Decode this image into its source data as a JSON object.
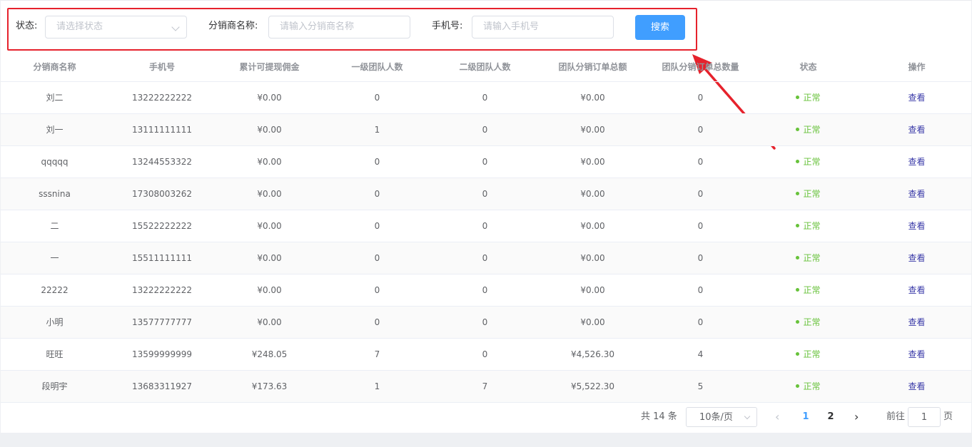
{
  "filters": {
    "status_label": "状态:",
    "status_placeholder": "请选择状态",
    "name_label": "分销商名称:",
    "name_placeholder": "请输入分销商名称",
    "phone_label": "手机号:",
    "phone_placeholder": "请输入手机号",
    "search_label": "搜索"
  },
  "table": {
    "headers": [
      "分销商名称",
      "手机号",
      "累计可提现佣金",
      "一级团队人数",
      "二级团队人数",
      "团队分销订单总额",
      "团队分销订单总数量",
      "状态",
      "操作"
    ],
    "rows": [
      {
        "name": "刘二",
        "phone": "13222222222",
        "commission": "¥0.00",
        "level1": "0",
        "level2": "0",
        "order_total": "¥0.00",
        "order_count": "0",
        "status": "正常",
        "action": "查看"
      },
      {
        "name": "刘一",
        "phone": "13111111111",
        "commission": "¥0.00",
        "level1": "1",
        "level2": "0",
        "order_total": "¥0.00",
        "order_count": "0",
        "status": "正常",
        "action": "查看"
      },
      {
        "name": "qqqqq",
        "phone": "13244553322",
        "commission": "¥0.00",
        "level1": "0",
        "level2": "0",
        "order_total": "¥0.00",
        "order_count": "0",
        "status": "正常",
        "action": "查看"
      },
      {
        "name": "sssnina",
        "phone": "17308003262",
        "commission": "¥0.00",
        "level1": "0",
        "level2": "0",
        "order_total": "¥0.00",
        "order_count": "0",
        "status": "正常",
        "action": "查看"
      },
      {
        "name": "二",
        "phone": "15522222222",
        "commission": "¥0.00",
        "level1": "0",
        "level2": "0",
        "order_total": "¥0.00",
        "order_count": "0",
        "status": "正常",
        "action": "查看"
      },
      {
        "name": "一",
        "phone": "15511111111",
        "commission": "¥0.00",
        "level1": "0",
        "level2": "0",
        "order_total": "¥0.00",
        "order_count": "0",
        "status": "正常",
        "action": "查看"
      },
      {
        "name": "22222",
        "phone": "13222222222",
        "commission": "¥0.00",
        "level1": "0",
        "level2": "0",
        "order_total": "¥0.00",
        "order_count": "0",
        "status": "正常",
        "action": "查看"
      },
      {
        "name": "小明",
        "phone": "13577777777",
        "commission": "¥0.00",
        "level1": "0",
        "level2": "0",
        "order_total": "¥0.00",
        "order_count": "0",
        "status": "正常",
        "action": "查看"
      },
      {
        "name": "旺旺",
        "phone": "13599999999",
        "commission": "¥248.05",
        "level1": "7",
        "level2": "0",
        "order_total": "¥4,526.30",
        "order_count": "4",
        "status": "正常",
        "action": "查看"
      },
      {
        "name": "段明宇",
        "phone": "13683311927",
        "commission": "¥173.63",
        "level1": "1",
        "level2": "7",
        "order_total": "¥5,522.30",
        "order_count": "5",
        "status": "正常",
        "action": "查看"
      }
    ]
  },
  "pagination": {
    "total": "共 14 条",
    "page_size": "10条/页",
    "pages": [
      "1",
      "2"
    ],
    "current": "1",
    "goto_label": "前往",
    "jump_value": "1",
    "unit_label": "页",
    "prev_glyph": "‹",
    "next_glyph": "›"
  },
  "colors": {
    "primary": "#409eff",
    "success": "#67c23a",
    "highlight": "#e6222c"
  }
}
